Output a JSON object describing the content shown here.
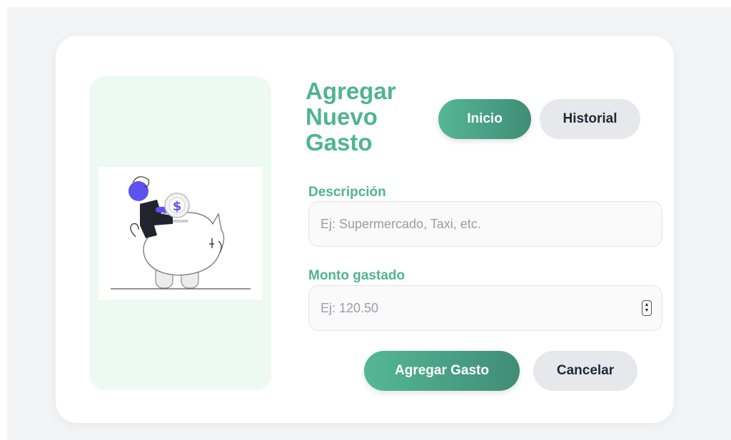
{
  "form": {
    "title_line1": "Agregar",
    "title_line2": "Nuevo",
    "title_line3": "Gasto"
  },
  "nav": {
    "home_label": "Inicio",
    "history_label": "Historial"
  },
  "fields": {
    "description_label": "Descripción",
    "description_placeholder": "Ej: Supermercado, Taxi, etc.",
    "description_value": "",
    "amount_label": "Monto gastado",
    "amount_placeholder": "Ej: 120.50",
    "amount_value": ""
  },
  "actions": {
    "submit_label": "Agregar Gasto",
    "cancel_label": "Cancelar"
  },
  "illustration": {
    "icon": "piggy-bank-coin-illustration",
    "coin_symbol": "$"
  },
  "colors": {
    "accent": "#4fb58f",
    "panel_bg": "#edfaf4",
    "figure_purple": "#5b52f0"
  }
}
